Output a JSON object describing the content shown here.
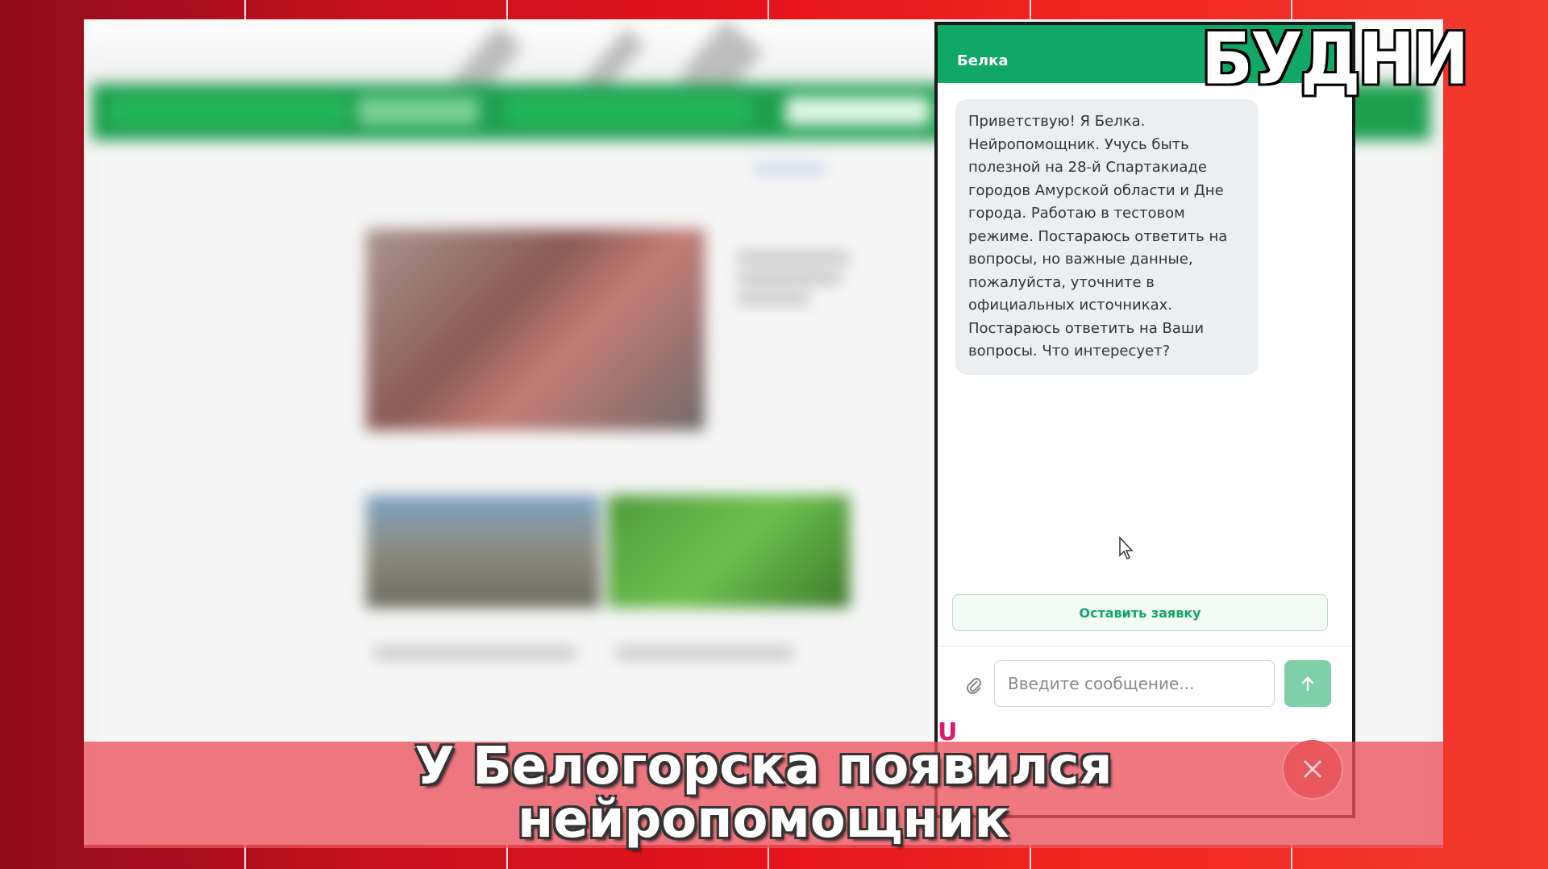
{
  "logo": {
    "text": "БУДНИ"
  },
  "chat": {
    "title": "Белка",
    "message": "Приветствую! Я Белка. Нейропомощник. Учусь быть полезной на 28-й Спартакиаде городов Амурской области и Дне города. Работаю в тестовом режиме. Постараюсь ответить на вопросы, но важные данные, пожалуйста, уточните в официальных источниках. Постараюсь ответить на Ваши вопросы. Что интересует?",
    "request_button": "Оставить заявку",
    "input_placeholder": "Введите сообщение...",
    "icons": {
      "attach": "paperclip-icon",
      "send": "arrow-up-icon",
      "close": "close-icon"
    },
    "accent_color": "#11a766"
  },
  "caption": {
    "line1": "У Белогорска появился",
    "line2": "нейропомощник"
  }
}
